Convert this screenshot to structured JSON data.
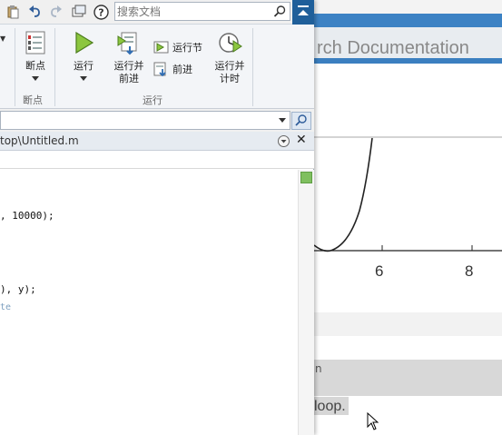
{
  "quick_access": {
    "search_placeholder": "搜索文档"
  },
  "ribbon": {
    "partial_dropdown": "▼",
    "breakpoint_label": "断点",
    "breakpoint_group_label": "断点",
    "run_label": "运行",
    "run_advance_label_1": "运行并",
    "run_advance_label_2": "前进",
    "run_section_label": "运行节",
    "advance_label": "前进",
    "run_time_label_1": "运行并",
    "run_time_label_2": "计时",
    "run_group_label": "运行"
  },
  "file": {
    "title_partial": "top\\Untitled.m"
  },
  "code_lines": [
    ", 10000);",
    "), y);",
    "te"
  ],
  "doc": {
    "search_partial": "rch Documentation",
    "tick_6": "6",
    "tick_8": "8",
    "heading_partial": "n",
    "selected_text": "loop."
  },
  "colors": {
    "accent_blue": "#3c82c4",
    "collapse_btn": "#1f5f9a"
  }
}
